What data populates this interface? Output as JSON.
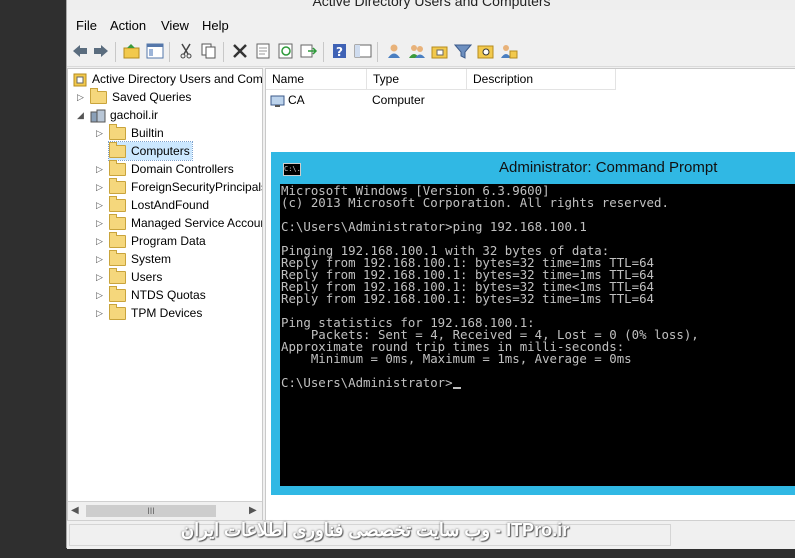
{
  "window": {
    "title": "Active Directory Users and Computers"
  },
  "menu": [
    "File",
    "Action",
    "View",
    "Help"
  ],
  "toolbar_icons": [
    "back-icon",
    "forward-icon",
    "up-folder-icon",
    "show-tree-icon",
    "cut-icon",
    "copy-icon",
    "delete-icon",
    "properties-icon",
    "refresh-icon",
    "export-icon",
    "help-icon",
    "console-icon",
    "user-icon",
    "group-icon",
    "ou-icon",
    "filter-icon",
    "find-icon",
    "move-icon"
  ],
  "tree": {
    "root": "Active Directory Users and Com",
    "saved_queries": "Saved Queries",
    "domain": "gachoil.ir",
    "children": [
      "Builtin",
      "Computers",
      "Domain Controllers",
      "ForeignSecurityPrincipals",
      "LostAndFound",
      "Managed Service Accour",
      "Program Data",
      "System",
      "Users",
      "NTDS Quotas",
      "TPM Devices"
    ],
    "selected": "Computers",
    "scroll_thumb": "III"
  },
  "list": {
    "columns": [
      "Name",
      "Type",
      "Description"
    ],
    "rows": [
      {
        "name": "CA",
        "type": "Computer",
        "description": ""
      }
    ]
  },
  "cmd": {
    "title": "Administrator: Command Prompt",
    "icon_text": "C:\\.",
    "lines": [
      "Microsoft Windows [Version 6.3.9600]",
      "(c) 2013 Microsoft Corporation. All rights reserved.",
      "",
      "C:\\Users\\Administrator>ping 192.168.100.1",
      "",
      "Pinging 192.168.100.1 with 32 bytes of data:",
      "Reply from 192.168.100.1: bytes=32 time=1ms TTL=64",
      "Reply from 192.168.100.1: bytes=32 time=1ms TTL=64",
      "Reply from 192.168.100.1: bytes=32 time<1ms TTL=64",
      "Reply from 192.168.100.1: bytes=32 time=1ms TTL=64",
      "",
      "Ping statistics for 192.168.100.1:",
      "    Packets: Sent = 4, Received = 4, Lost = 0 (0% loss),",
      "Approximate round trip times in milli-seconds:",
      "    Minimum = 0ms, Maximum = 1ms, Average = 0ms",
      "",
      "C:\\Users\\Administrator>"
    ]
  },
  "watermark": "ITPro.ir - وب سایت تخصصی فناوری اطلاعات ایران"
}
